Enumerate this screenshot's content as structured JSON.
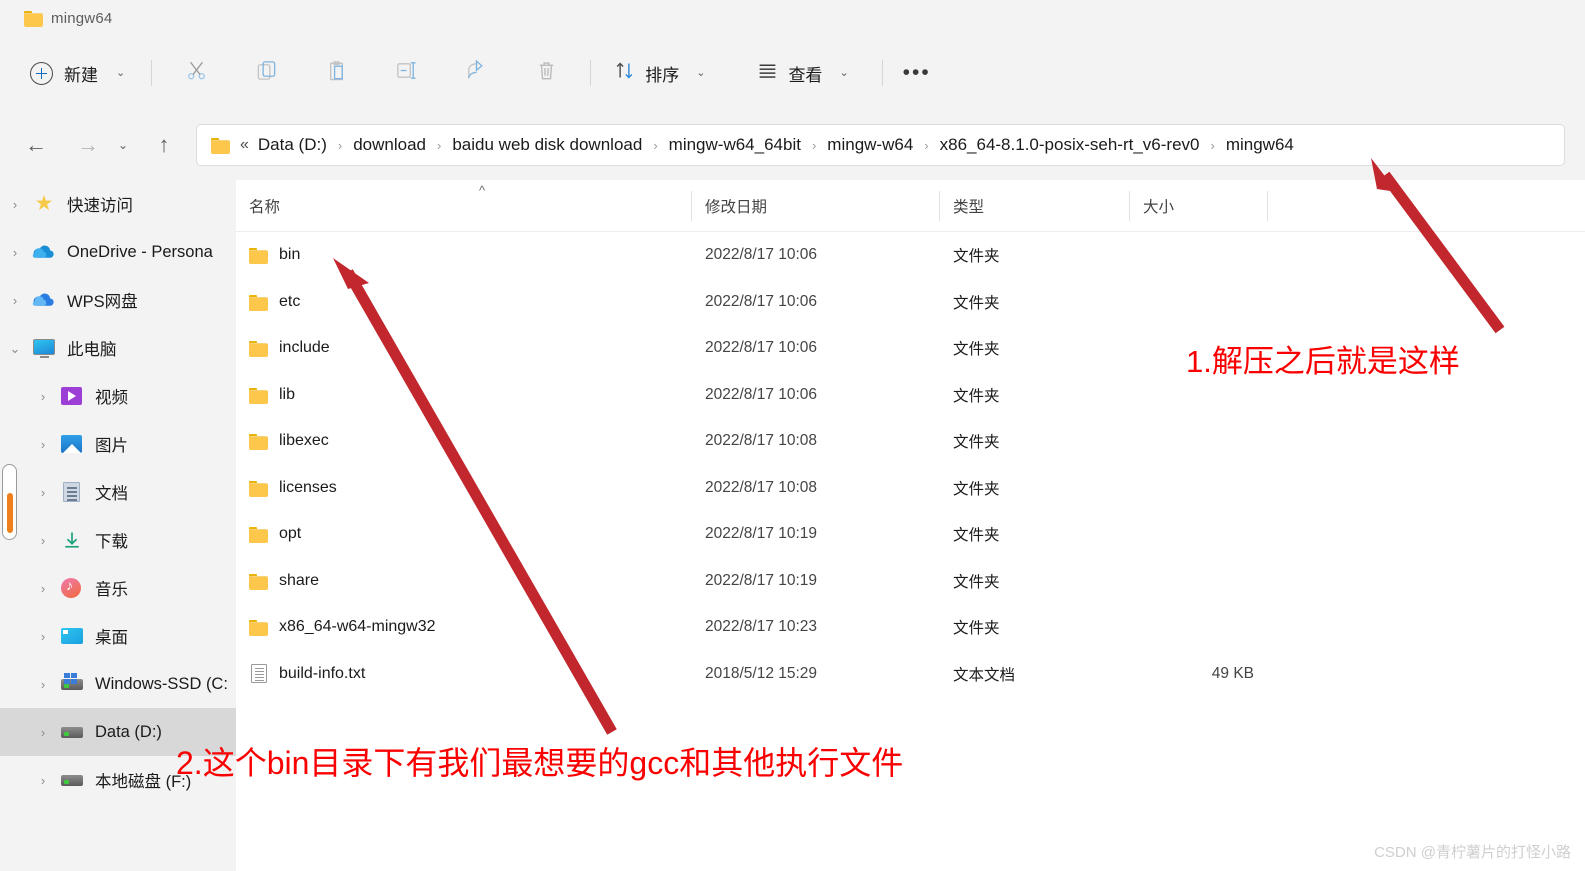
{
  "window": {
    "tab_title": "mingw64",
    "tab_folder_icon": "folder-icon"
  },
  "toolbar": {
    "new_label": "新建",
    "new_chevron": "⌄",
    "cut_icon": "scissors-icon",
    "copy_icon": "copy-icon",
    "paste_icon": "paste-icon",
    "rename_icon": "rename-icon",
    "share_icon": "share-icon",
    "delete_icon": "trash-icon",
    "sort_label": "排序",
    "sort_icon": "sort-arrows-icon",
    "view_label": "查看",
    "view_icon": "view-lines-icon",
    "more_label": "•••"
  },
  "navbar": {
    "back_icon": "←",
    "forward_icon": "→",
    "history_chevron": "⌄",
    "up_icon": "↑",
    "address_folder_icon": "folder-icon",
    "overflow_mark": "«",
    "separator": "›",
    "crumbs": [
      "Data (D:)",
      "download",
      "baidu web disk download",
      "mingw-w64_64bit",
      "mingw-w64",
      "x86_64-8.1.0-posix-seh-rt_v6-rev0",
      "mingw64"
    ]
  },
  "sidebar": {
    "items": [
      {
        "label": "快速访问",
        "icon": "star-icon",
        "twisty": "›",
        "indent": false,
        "selected": false
      },
      {
        "label": "OneDrive - Persona",
        "icon": "onedrive-cloud-icon",
        "twisty": "›",
        "indent": false,
        "selected": false
      },
      {
        "label": "WPS网盘",
        "icon": "wps-cloud-icon",
        "twisty": "›",
        "indent": false,
        "selected": false
      },
      {
        "label": "此电脑",
        "icon": "this-pc-monitor-icon",
        "twisty": "⌄",
        "indent": false,
        "selected": false
      },
      {
        "label": "视频",
        "icon": "videos-icon",
        "twisty": "›",
        "indent": true,
        "selected": false
      },
      {
        "label": "图片",
        "icon": "pictures-icon",
        "twisty": "›",
        "indent": true,
        "selected": false
      },
      {
        "label": "文档",
        "icon": "documents-icon",
        "twisty": "›",
        "indent": true,
        "selected": false
      },
      {
        "label": "下载",
        "icon": "downloads-icon",
        "twisty": "›",
        "indent": true,
        "selected": false
      },
      {
        "label": "音乐",
        "icon": "music-icon",
        "twisty": "›",
        "indent": true,
        "selected": false
      },
      {
        "label": "桌面",
        "icon": "desktop-icon",
        "twisty": "›",
        "indent": true,
        "selected": false
      },
      {
        "label": "Windows-SSD (C:",
        "icon": "windows-drive-icon",
        "twisty": "›",
        "indent": true,
        "selected": false
      },
      {
        "label": "Data (D:)",
        "icon": "drive-icon",
        "twisty": "›",
        "indent": true,
        "selected": true
      },
      {
        "label": "本地磁盘 (F:)",
        "icon": "drive-icon",
        "twisty": "›",
        "indent": true,
        "selected": false
      }
    ],
    "scrollbar": {
      "thumb_color": "#ef7f1a"
    }
  },
  "filelist": {
    "columns": [
      {
        "label": "名称",
        "key": "name"
      },
      {
        "label": "修改日期",
        "key": "date"
      },
      {
        "label": "类型",
        "key": "type"
      },
      {
        "label": "大小",
        "key": "size"
      }
    ],
    "sort_indicator": "^",
    "rows": [
      {
        "name": "bin",
        "icon": "folder-icon",
        "date": "2022/8/17 10:06",
        "type": "文件夹",
        "size": ""
      },
      {
        "name": "etc",
        "icon": "folder-icon",
        "date": "2022/8/17 10:06",
        "type": "文件夹",
        "size": ""
      },
      {
        "name": "include",
        "icon": "folder-icon",
        "date": "2022/8/17 10:06",
        "type": "文件夹",
        "size": ""
      },
      {
        "name": "lib",
        "icon": "folder-icon",
        "date": "2022/8/17 10:06",
        "type": "文件夹",
        "size": ""
      },
      {
        "name": "libexec",
        "icon": "folder-icon",
        "date": "2022/8/17 10:08",
        "type": "文件夹",
        "size": ""
      },
      {
        "name": "licenses",
        "icon": "folder-icon",
        "date": "2022/8/17 10:08",
        "type": "文件夹",
        "size": ""
      },
      {
        "name": "opt",
        "icon": "folder-icon",
        "date": "2022/8/17 10:19",
        "type": "文件夹",
        "size": ""
      },
      {
        "name": "share",
        "icon": "folder-icon",
        "date": "2022/8/17 10:19",
        "type": "文件夹",
        "size": ""
      },
      {
        "name": "x86_64-w64-mingw32",
        "icon": "folder-icon",
        "date": "2022/8/17 10:23",
        "type": "文件夹",
        "size": ""
      },
      {
        "name": "build-info.txt",
        "icon": "text-file-icon",
        "date": "2018/5/12 15:29",
        "type": "文本文档",
        "size": "49 KB"
      }
    ]
  },
  "annotations": {
    "color": "#fa0000",
    "note1": "1.解压之后就是这样",
    "note2": "2.这个bin目录下有我们最想要的gcc和其他执行文件",
    "arrow1_name": "arrow-to-mingw64-breadcrumb",
    "arrow2_name": "arrow-to-bin-folder"
  },
  "watermark": "CSDN @青柠薯片的打怪小路"
}
